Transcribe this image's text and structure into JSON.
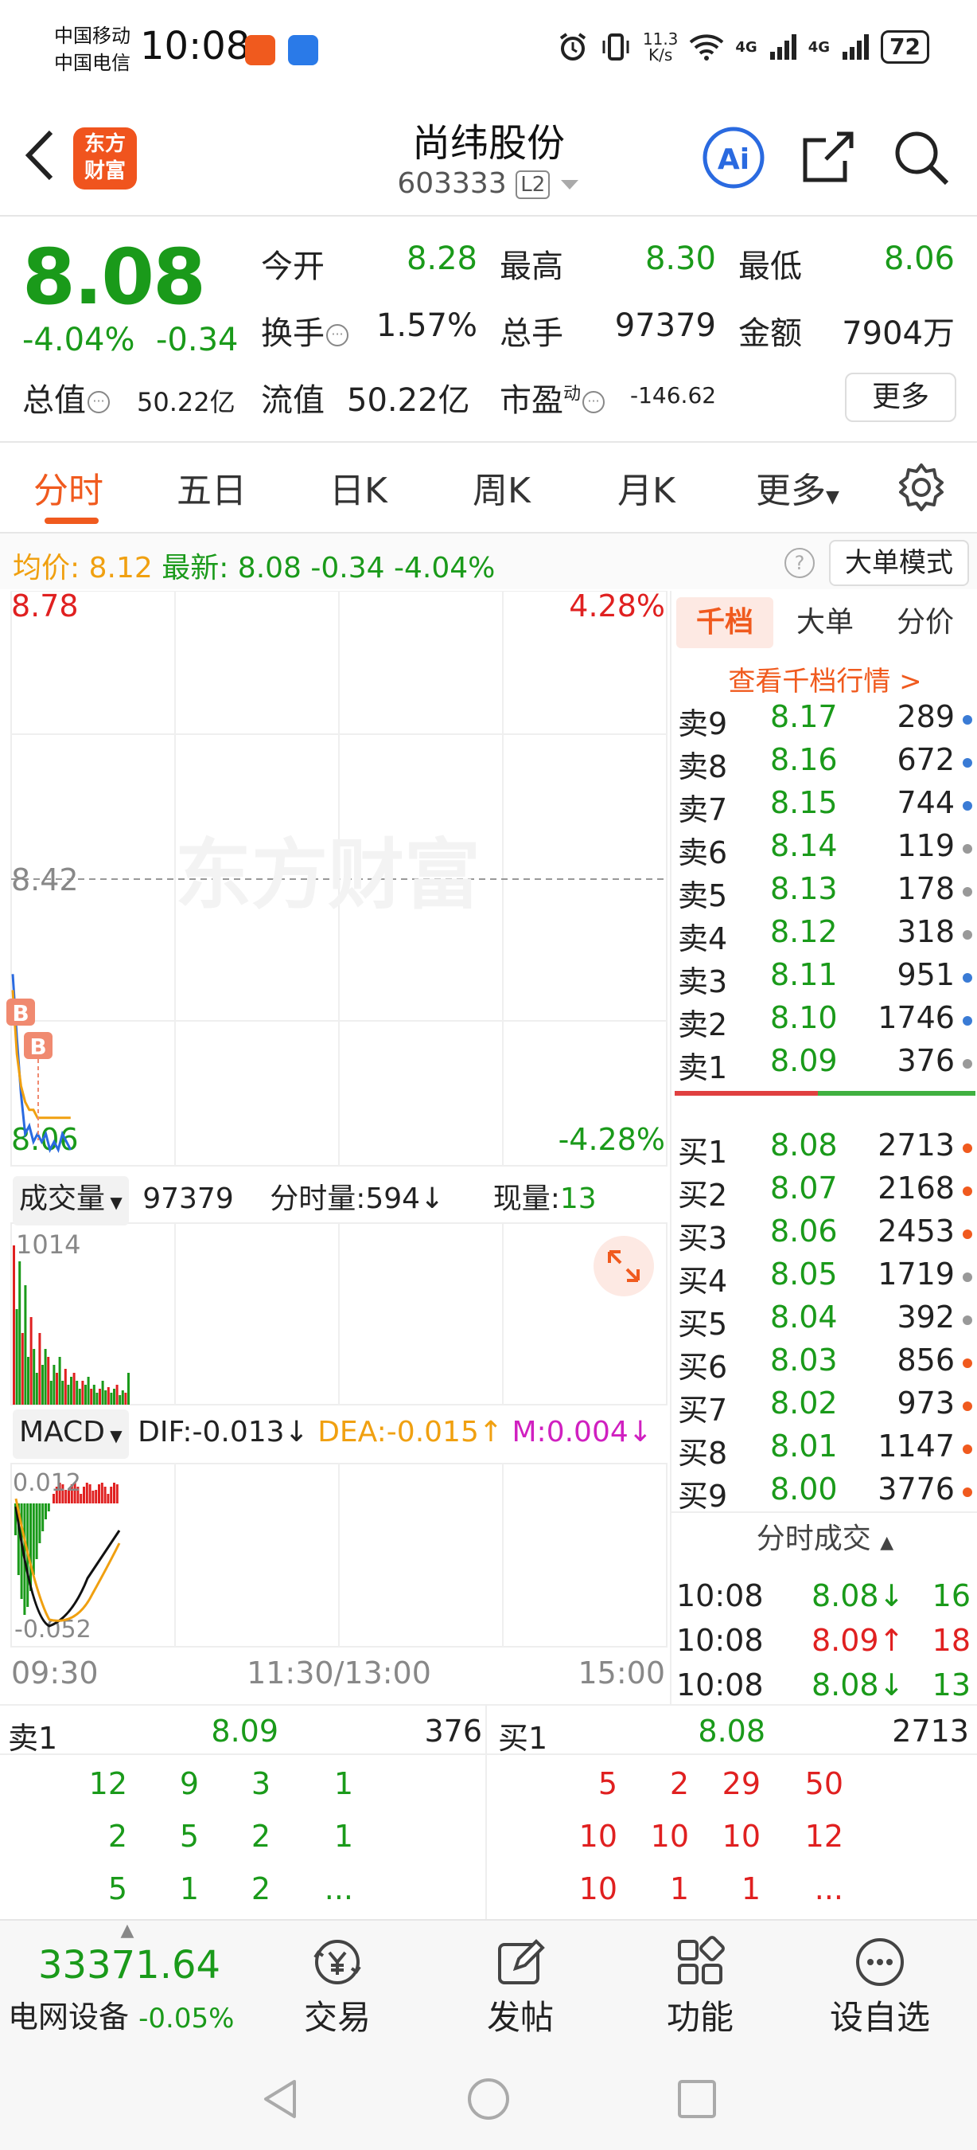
{
  "status": {
    "carrier1": "中国移动",
    "carrier2": "中国电信",
    "time": "10:08",
    "speed_val": "11.3",
    "speed_unit": "K/s",
    "net1": "4G",
    "net2": "4G",
    "battery": "72"
  },
  "header": {
    "logo_line1": "东方",
    "logo_line2": "财富",
    "name": "尚纬股份",
    "code": "603333",
    "level": "L2",
    "ai_label": "Ai"
  },
  "quote": {
    "price": "8.08",
    "change_pct": "-4.04%",
    "change": "-0.34",
    "open_label": "今开",
    "open": "8.28",
    "high_label": "最高",
    "high": "8.30",
    "low_label": "最低",
    "low": "8.06",
    "turnover_label": "换手",
    "turnover": "1.57%",
    "volume_label": "总手",
    "volume": "97379",
    "amount_label": "金额",
    "amount": "7904万",
    "mktcap_label": "总值",
    "mktcap": "50.22亿",
    "float_label": "流值",
    "float_cap": "50.22亿",
    "pe_label": "市盈",
    "pe_sup": "动",
    "pe": "-146.62",
    "more": "更多"
  },
  "tabs": [
    "分时",
    "五日",
    "日K",
    "周K",
    "月K",
    "更多"
  ],
  "avg": {
    "avg_label": "均价:",
    "avg": "8.12",
    "latest_label": "最新:",
    "latest": "8.08",
    "chg": "-0.34",
    "pct": "-4.04%",
    "big_order": "大单模式"
  },
  "chart": {
    "y_top": "8.78",
    "y_top_pct": "4.28%",
    "y_mid": "8.42",
    "y_bot": "8.06",
    "y_bot_pct": "-4.28%",
    "watermark": "东方财富",
    "marker_b": "B",
    "vol_label": "成交量",
    "vol_total": "97379",
    "vol_period_label": "分时量:",
    "vol_period": "594",
    "vol_period_arrow": "↓",
    "vol_now_label": "现量:",
    "vol_now": "13",
    "vol_max": "1014",
    "macd_label": "MACD",
    "dif_label": "DIF:",
    "dif": "-0.013",
    "dif_arrow": "↓",
    "dea_label": "DEA:",
    "dea": "-0.015",
    "dea_arrow": "↑",
    "m_label": "M:",
    "m": "0.004",
    "m_arrow": "↓",
    "macd_top": "0.012",
    "macd_bot": "-0.052",
    "time_start": "09:30",
    "time_mid": "11:30/13:00",
    "time_end": "15:00"
  },
  "chart_data": {
    "type": "line",
    "title": "",
    "ylim": [
      8.06,
      8.78
    ],
    "x_labels": [
      "09:30",
      "11:30/13:00",
      "15:00"
    ],
    "series": [
      {
        "values": [
          8.3,
          8.22,
          8.15,
          8.1,
          8.11,
          8.09,
          8.1,
          8.09,
          8.1,
          8.08,
          8.09,
          8.08,
          8.1,
          8.09,
          8.08
        ]
      },
      {
        "values": [
          8.28,
          8.2,
          8.16,
          8.14,
          8.13,
          8.13,
          8.12,
          8.12,
          8.12,
          8.12,
          8.12,
          8.12,
          8.12,
          8.12,
          8.12
        ]
      }
    ]
  },
  "book": {
    "tabs": [
      "千档",
      "大单",
      "分价"
    ],
    "link": "查看千档行情 >",
    "asks": [
      {
        "label": "卖9",
        "price": "8.17",
        "qty": "289",
        "dot": "#3a7bd5"
      },
      {
        "label": "卖8",
        "price": "8.16",
        "qty": "672",
        "dot": "#3a7bd5"
      },
      {
        "label": "卖7",
        "price": "8.15",
        "qty": "744",
        "dot": "#3a7bd5"
      },
      {
        "label": "卖6",
        "price": "8.14",
        "qty": "119",
        "dot": "#999999"
      },
      {
        "label": "卖5",
        "price": "8.13",
        "qty": "178",
        "dot": "#999999"
      },
      {
        "label": "卖4",
        "price": "8.12",
        "qty": "318",
        "dot": "#999999"
      },
      {
        "label": "卖3",
        "price": "8.11",
        "qty": "951",
        "dot": "#3a7bd5"
      },
      {
        "label": "卖2",
        "price": "8.10",
        "qty": "1746",
        "dot": "#3a7bd5"
      },
      {
        "label": "卖1",
        "price": "8.09",
        "qty": "376",
        "dot": "#999999"
      }
    ],
    "bids": [
      {
        "label": "买1",
        "price": "8.08",
        "qty": "2713",
        "dot": "#f05a1e"
      },
      {
        "label": "买2",
        "price": "8.07",
        "qty": "2168",
        "dot": "#f05a1e"
      },
      {
        "label": "买3",
        "price": "8.06",
        "qty": "2453",
        "dot": "#f05a1e"
      },
      {
        "label": "买4",
        "price": "8.05",
        "qty": "1719",
        "dot": "#999999"
      },
      {
        "label": "买5",
        "price": "8.04",
        "qty": "392",
        "dot": "#999999"
      },
      {
        "label": "买6",
        "price": "8.03",
        "qty": "856",
        "dot": "#f05a1e"
      },
      {
        "label": "买7",
        "price": "8.02",
        "qty": "973",
        "dot": "#f05a1e"
      },
      {
        "label": "买8",
        "price": "8.01",
        "qty": "1147",
        "dot": "#f05a1e"
      },
      {
        "label": "买9",
        "price": "8.00",
        "qty": "3776",
        "dot": "#f05a1e"
      }
    ],
    "ticks_title": "分时成交",
    "ticks": [
      {
        "time": "10:08",
        "price": "8.08",
        "dir": "↓",
        "qty": "16",
        "color": "#1a9a1a"
      },
      {
        "time": "10:08",
        "price": "8.09",
        "dir": "↑",
        "qty": "18",
        "color": "#e02020"
      },
      {
        "time": "10:08",
        "price": "8.08",
        "dir": "↓",
        "qty": "13",
        "color": "#1a9a1a"
      }
    ]
  },
  "detail": {
    "sell_label": "卖1",
    "sell_price": "8.09",
    "sell_qty": "376",
    "buy_label": "买1",
    "buy_price": "8.08",
    "buy_qty": "2713",
    "sell_orders": [
      [
        "12",
        "9",
        "3",
        "1"
      ],
      [
        "2",
        "5",
        "2",
        "1"
      ],
      [
        "5",
        "1",
        "2",
        "..."
      ]
    ],
    "buy_orders": [
      [
        "5",
        "2",
        "29",
        "50"
      ],
      [
        "10",
        "10",
        "10",
        "12"
      ],
      [
        "10",
        "1",
        "1",
        "..."
      ]
    ]
  },
  "bottomnav": {
    "index_value": "33371.64",
    "index_name": "电网设备",
    "index_chg": "-0.05%",
    "items": [
      "交易",
      "发帖",
      "功能",
      "设自选"
    ]
  }
}
